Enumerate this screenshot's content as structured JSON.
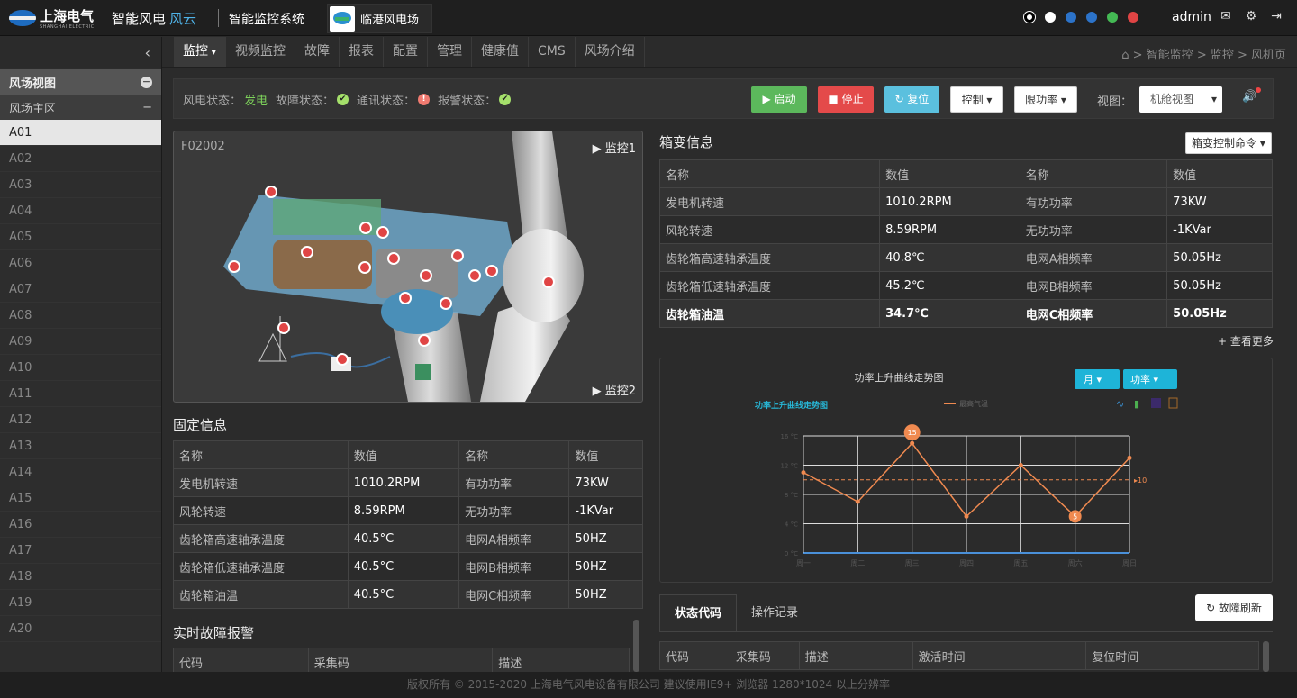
{
  "header": {
    "logo_text": "上海电气",
    "logo_sub": "SHANGHAI ELECTRIC",
    "brand": "智能风电",
    "brand_suffix": "风云",
    "system": "智能监控系统",
    "farm": "临港风电场",
    "status_dots": [
      "#ffffff",
      "#ffffff",
      "#2c73c9",
      "#2c73c9",
      "#44b954",
      "#e04444"
    ],
    "user": "admin"
  },
  "sidebar": {
    "title": "风场视图",
    "group": "风场主区",
    "items": [
      "A01",
      "A02",
      "A03",
      "A04",
      "A05",
      "A06",
      "A07",
      "A08",
      "A09",
      "A10",
      "A11",
      "A12",
      "A13",
      "A14",
      "A15",
      "A16",
      "A17",
      "A18",
      "A19",
      "A20"
    ],
    "active": "A01"
  },
  "nav": {
    "tabs": [
      "监控",
      "视频监控",
      "故障",
      "报表",
      "配置",
      "管理",
      "健康值",
      "CMS",
      "风场介绍"
    ],
    "active": 0,
    "breadcrumb": "> 智能监控 > 监控 > 风机页"
  },
  "status": {
    "wind_label": "风电状态：",
    "wind_value": "发电",
    "fault_label": "故障状态：",
    "comm_label": "通讯状态：",
    "alarm_label": "报警状态：",
    "btn_start": "▶ 启动",
    "btn_stop": "■ 停止",
    "btn_reset": "↻ 复位",
    "btn_control": "控制 ▾",
    "btn_limit": "限功率 ▾",
    "view_label": "视图：",
    "view_value": "机舱视图"
  },
  "turbine": {
    "id": "F02002",
    "monitor1": "监控1",
    "monitor2": "监控2"
  },
  "fixed_info": {
    "title": "固定信息",
    "headers": [
      "名称",
      "数值",
      "名称",
      "数值"
    ],
    "rows": [
      [
        "发电机转速",
        "1010.2RPM",
        "有功功率",
        "73KW"
      ],
      [
        "风轮转速",
        "8.59RPM",
        "无功功率",
        "-1KVar"
      ],
      [
        "齿轮箱高速轴承温度",
        "40.5°C",
        "电网A相频率",
        "50HZ"
      ],
      [
        "齿轮箱低速轴承温度",
        "40.5°C",
        "电网B相频率",
        "50HZ"
      ],
      [
        "齿轮箱油温",
        "40.5°C",
        "电网C相频率",
        "50HZ"
      ]
    ]
  },
  "fault": {
    "title": "实时故障报警",
    "headers": [
      "代码",
      "采集码",
      "描述"
    ]
  },
  "box": {
    "title": "箱变信息",
    "command": "箱变控制命令 ▾",
    "headers": [
      "名称",
      "数值",
      "名称",
      "数值"
    ],
    "rows": [
      [
        "发电机转速",
        "1010.2RPM",
        "有功功率",
        "73KW"
      ],
      [
        "风轮转速",
        "8.59RPM",
        "无功功率",
        "-1KVar"
      ],
      [
        "齿轮箱高速轴承温度",
        "40.8℃",
        "电网A相频率",
        "50.05Hz"
      ],
      [
        "齿轮箱低速轴承温度",
        "45.2℃",
        "电网B相频率",
        "50.05Hz"
      ],
      [
        "齿轮箱油温",
        "34.7℃",
        "电网C相频率",
        "50.05Hz"
      ]
    ],
    "more": "+ 查看更多"
  },
  "chart_data": {
    "type": "line",
    "title": "功率上升曲线走势图",
    "subtitle": "功率上升曲线走势图",
    "legend": "最高气温",
    "period_btn": "月",
    "metric_btn": "功率",
    "categories": [
      "周一",
      "周二",
      "周三",
      "周四",
      "周五",
      "周六",
      "周日"
    ],
    "series": [
      {
        "name": "最高气温",
        "values": [
          11,
          7,
          15,
          5,
          12,
          5,
          13
        ]
      }
    ],
    "average": 10,
    "max_label": "15",
    "min_label": "5",
    "ylim": [
      0,
      16
    ],
    "yticks": [
      "0 °C",
      "4 °C",
      "8 °C",
      "12 °C",
      "16 °C"
    ],
    "color": "#f08a50"
  },
  "lower": {
    "tabs": [
      "状态代码",
      "操作记录"
    ],
    "refresh": "↻ 故障刷新",
    "headers": [
      "代码",
      "采集码",
      "描述",
      "激活时间",
      "复位时间"
    ]
  },
  "footer": "版权所有 © 2015-2020 上海电气风电设备有限公司 建议使用IE9+ 浏览器 1280*1024 以上分辨率"
}
